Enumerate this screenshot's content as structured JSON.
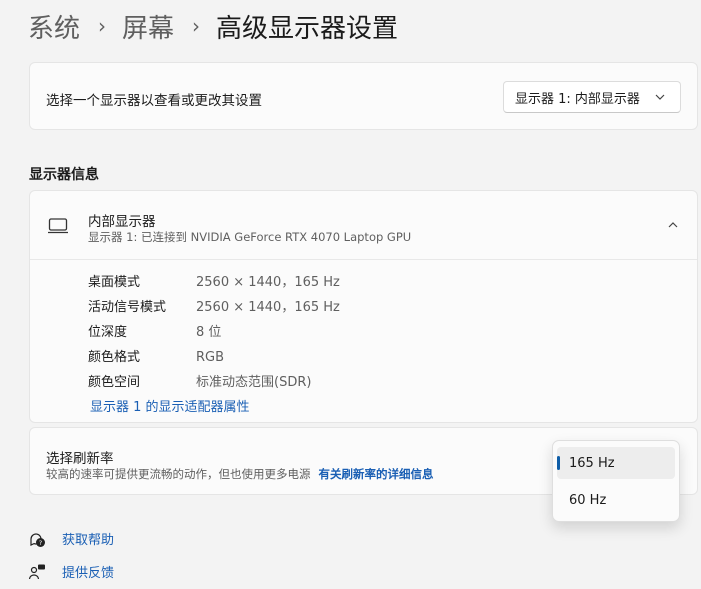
{
  "breadcrumb": {
    "system": "系统",
    "display": "屏幕",
    "current": "高级显示器设置"
  },
  "select_display": {
    "label": "选择一个显示器以查看或更改其设置",
    "value": "显示器 1: 内部显示器"
  },
  "section_title": "显示器信息",
  "display_info": {
    "name": "内部显示器",
    "subtitle": "显示器 1: 已连接到 NVIDIA GeForce RTX 4070 Laptop GPU",
    "rows": [
      {
        "key": "桌面模式",
        "value": "2560 × 1440，165 Hz"
      },
      {
        "key": "活动信号模式",
        "value": "2560 × 1440，165 Hz"
      },
      {
        "key": "位深度",
        "value": "8 位"
      },
      {
        "key": "颜色格式",
        "value": "RGB"
      },
      {
        "key": "颜色空间",
        "value": "标准动态范围(SDR)"
      }
    ],
    "adapter_link": "显示器 1 的显示适配器属性"
  },
  "refresh": {
    "title": "选择刷新率",
    "desc": "较高的速率可提供更流畅的动作，但也使用更多电源",
    "link": "有关刷新率的详细信息",
    "options": [
      "165 Hz",
      "60 Hz"
    ],
    "selected": "165 Hz"
  },
  "footer": {
    "help": "获取帮助",
    "feedback": "提供反馈"
  },
  "colors": {
    "accent": "#0f5ea8",
    "link": "#1a5fb4",
    "background": "#f3f3f3",
    "card": "#fbfbfb"
  }
}
